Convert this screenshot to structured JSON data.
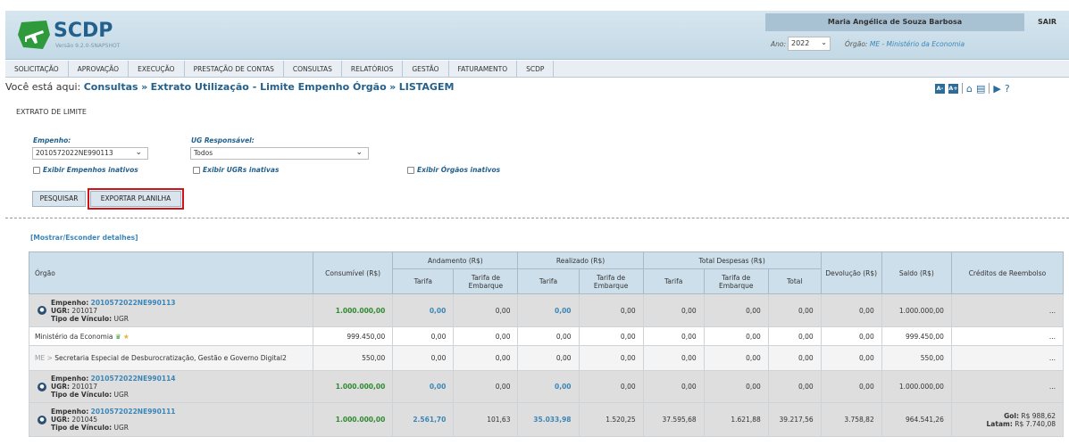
{
  "header": {
    "logo_text": "SCDP",
    "version": "Versão 9.2.0-SNAPSHOT",
    "user_name": "Maria Angélica de Souza Barbosa",
    "logout": "SAIR",
    "year_label": "Ano:",
    "year_value": "2022",
    "orgao_label": "Órgão:",
    "orgao_value": "ME - Ministério da Economia"
  },
  "menu": [
    "SOLICITAÇÃO",
    "APROVAÇÃO",
    "EXECUÇÃO",
    "PRESTAÇÃO DE CONTAS",
    "CONSULTAS",
    "RELATÓRIOS",
    "GESTÃO",
    "FATURAMENTO",
    "SCDP"
  ],
  "breadcrumb": {
    "prefix": "Você está aqui:",
    "item1": "Consultas",
    "item2": "Extrato Utilização - Limite Empenho Órgão",
    "item3": "LISTAGEM"
  },
  "tools": {
    "font_decrease": "A-",
    "font_increase": "A+"
  },
  "form": {
    "section_title": "EXTRATO DE LIMITE",
    "empenho_label": "Empenho:",
    "empenho_value": "2010572022NE990113",
    "ug_label": "UG Responsável:",
    "ug_value": "Todos",
    "chk_empenhos": "Exibir Empenhos inativos",
    "chk_ugrs": "Exibir UGRs inativas",
    "chk_orgaos": "Exibir Órgãos inativos",
    "btn_search": "PESQUISAR",
    "btn_export": "EXPORTAR PLANILHA"
  },
  "toggle_details": "[Mostrar/Esconder detalhes]",
  "table": {
    "headers": {
      "orgao": "Órgão",
      "consumivel": "Consumível (R$)",
      "andamento": "Andamento (R$)",
      "realizado": "Realizado (R$)",
      "total_despesas": "Total Despesas (R$)",
      "devolucao": "Devolução (R$)",
      "saldo": "Saldo (R$)",
      "creditos": "Créditos de Reembolso",
      "tarifa": "Tarifa",
      "tarifa_embarque": "Tarifa de Embarque",
      "total": "Total"
    },
    "labels": {
      "empenho": "Empenho:",
      "ugr": "UGR:",
      "tipo": "Tipo de Vínculo:"
    },
    "rows": [
      {
        "empenho": "2010572022NE990113",
        "ugr": "201017",
        "tipo": "UGR",
        "consumivel": "1.000.000,00",
        "and_tarifa": "0,00",
        "and_emb": "0,00",
        "real_tarifa": "0,00",
        "real_emb": "0,00",
        "tot_tarifa": "0,00",
        "tot_emb": "0,00",
        "total": "0,00",
        "devolucao": "0,00",
        "saldo": "1.000.000,00",
        "creditos": "..."
      },
      {
        "orgao": "Ministério da Economia",
        "consumivel": "999.450,00",
        "and_tarifa": "0,00",
        "and_emb": "0,00",
        "real_tarifa": "0,00",
        "real_emb": "0,00",
        "tot_tarifa": "0,00",
        "tot_emb": "0,00",
        "total": "0,00",
        "devolucao": "0,00",
        "saldo": "999.450,00",
        "creditos": "..."
      },
      {
        "orgao_prefix": "ME >",
        "orgao": "Secretaria Especial de Desburocratização, Gestão e Governo Digital2",
        "consumivel": "550,00",
        "and_tarifa": "0,00",
        "and_emb": "0,00",
        "real_tarifa": "0,00",
        "real_emb": "0,00",
        "tot_tarifa": "0,00",
        "tot_emb": "0,00",
        "total": "0,00",
        "devolucao": "0,00",
        "saldo": "550,00",
        "creditos": "..."
      },
      {
        "empenho": "2010572022NE990114",
        "ugr": "201017",
        "tipo": "UGR",
        "consumivel": "1.000.000,00",
        "and_tarifa": "0,00",
        "and_emb": "0,00",
        "real_tarifa": "0,00",
        "real_emb": "0,00",
        "tot_tarifa": "0,00",
        "tot_emb": "0,00",
        "total": "0,00",
        "devolucao": "0,00",
        "saldo": "1.000.000,00",
        "creditos": "..."
      },
      {
        "empenho": "2010572022NE990111",
        "ugr": "201045",
        "tipo": "UGR",
        "consumivel": "1.000.000,00",
        "and_tarifa": "2.561,70",
        "and_emb": "101,63",
        "real_tarifa": "35.033,98",
        "real_emb": "1.520,25",
        "tot_tarifa": "37.595,68",
        "tot_emb": "1.621,88",
        "total": "39.217,56",
        "devolucao": "3.758,82",
        "saldo": "964.541,26",
        "cred_gol_label": "Gol:",
        "cred_gol": "R$ 988,62",
        "cred_latam_label": "Latam:",
        "cred_latam": "R$ 7.740,08"
      }
    ]
  },
  "colors": {
    "brand": "#23618c",
    "link": "#3b86b8",
    "highlight": "#d0121b",
    "green": "#2f8a2f"
  }
}
